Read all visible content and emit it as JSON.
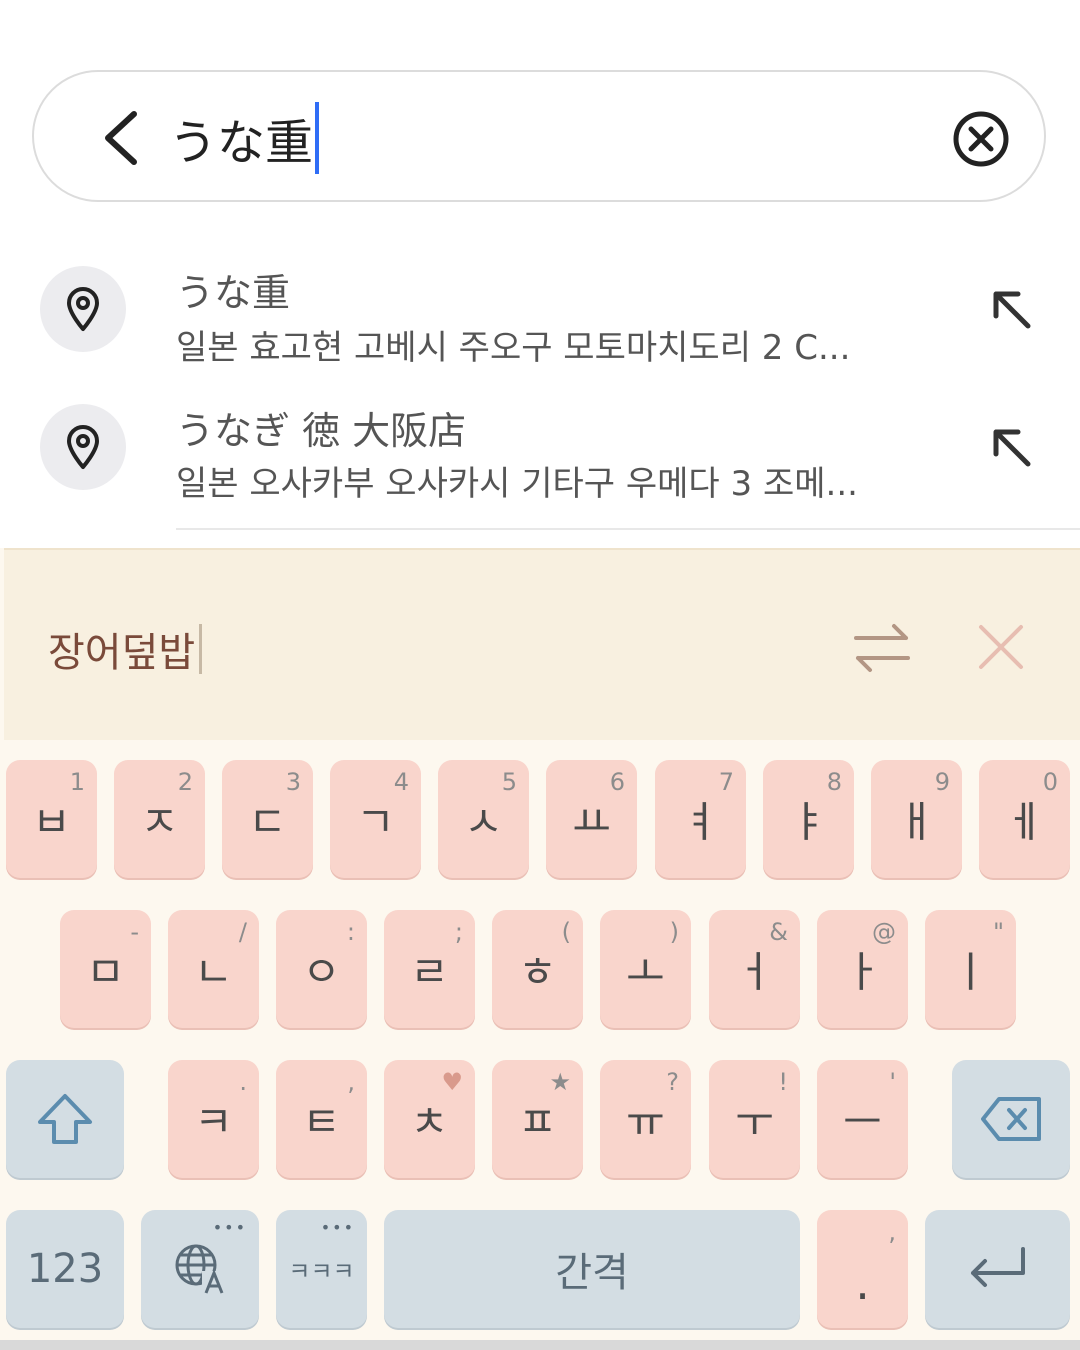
{
  "search": {
    "query": "うな重"
  },
  "results": [
    {
      "title": "うな重",
      "address": "일본 효고현 고베시 주오구 모토마치도리 2 C..."
    },
    {
      "title": "うなぎ 徳 大阪店",
      "address": "일본 오사카부 오사카시 기타구 우메다 3 조메..."
    }
  ],
  "translation": {
    "text": "장어덮밥"
  },
  "keyboard": {
    "row1": [
      {
        "main": "ㅂ",
        "hint": "1"
      },
      {
        "main": "ㅈ",
        "hint": "2"
      },
      {
        "main": "ㄷ",
        "hint": "3"
      },
      {
        "main": "ㄱ",
        "hint": "4"
      },
      {
        "main": "ㅅ",
        "hint": "5"
      },
      {
        "main": "ㅛ",
        "hint": "6"
      },
      {
        "main": "ㅕ",
        "hint": "7"
      },
      {
        "main": "ㅑ",
        "hint": "8"
      },
      {
        "main": "ㅐ",
        "hint": "9"
      },
      {
        "main": "ㅔ",
        "hint": "0"
      }
    ],
    "row2": [
      {
        "main": "ㅁ",
        "hint": "-"
      },
      {
        "main": "ㄴ",
        "hint": "/"
      },
      {
        "main": "ㅇ",
        "hint": ":"
      },
      {
        "main": "ㄹ",
        "hint": ";"
      },
      {
        "main": "ㅎ",
        "hint": "("
      },
      {
        "main": "ㅗ",
        "hint": ")"
      },
      {
        "main": "ㅓ",
        "hint": "&"
      },
      {
        "main": "ㅏ",
        "hint": "@"
      },
      {
        "main": "ㅣ",
        "hint": "\""
      }
    ],
    "row3": [
      {
        "main": "ㅋ",
        "hint": "."
      },
      {
        "main": "ㅌ",
        "hint": ","
      },
      {
        "main": "ㅊ",
        "hint": "♥"
      },
      {
        "main": "ㅍ",
        "hint": "★"
      },
      {
        "main": "ㅠ",
        "hint": "?"
      },
      {
        "main": "ㅜ",
        "hint": "!"
      },
      {
        "main": "ㅡ",
        "hint": "'"
      }
    ],
    "numbers_label": "123",
    "lang_dots": "•••",
    "laugh_label": "ㅋㅋㅋ",
    "laugh_dots": "•••",
    "space_label": "간격",
    "period_label": ".",
    "period_hint": ","
  },
  "colors": {
    "caret": "#2f6df6",
    "key_pink": "#f9d5cc",
    "key_gray": "#d3dde3",
    "translation_bg": "#f8f0e0",
    "keyboard_bg": "#fdf8ef"
  }
}
